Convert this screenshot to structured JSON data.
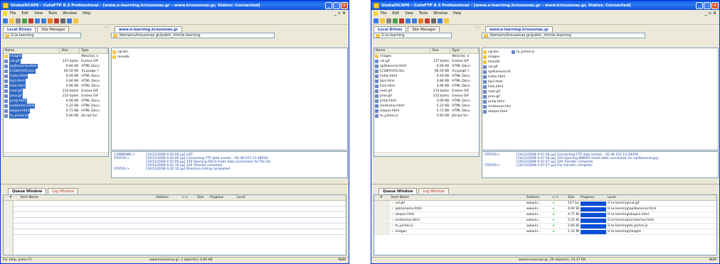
{
  "windows": [
    {
      "title": "GlobalSCAPE - CuteFTP 8.3 Professional - [www.e-learning.krousonas.gr - www.krousonas.gr, Status: Connected]",
      "menu": [
        "File",
        "Edit",
        "View",
        "Tools",
        "Window",
        "Help"
      ],
      "local_tabs": [
        "Local Drives",
        "Site Manager"
      ],
      "remote_tab": "www.e-learning.krousonas.gr",
      "local_path": "G:\\e-learning",
      "remote_path": "/domains/krousonas.gr/public_html/e-learning",
      "local_columns": [
        "Name",
        "Size",
        "Type"
      ],
      "local_files": [
        {
          "name": "images",
          "size": "",
          "type": "Φάκελος α",
          "folder": true
        },
        {
          "name": "cal.gif",
          "size": "127 bytes",
          "type": "Εικόνα GIF"
        },
        {
          "name": "aplikanonia.html",
          "size": "6.94 KB",
          "type": "HTML Docu"
        },
        {
          "name": "EΞΩΦΥΛΛΟ.doc",
          "size": "60.50 KB",
          "type": "Έγγραφο τ"
        },
        {
          "name": "index.html",
          "size": "6.49 KB",
          "type": "HTML Docu"
        },
        {
          "name": "lipsi.html",
          "size": "4.84 KB",
          "type": "HTML Docu"
        },
        {
          "name": "lista.html",
          "size": "4.96 KB",
          "type": "HTML Docu"
        },
        {
          "name": "next.gif",
          "size": "214 bytes",
          "type": "Εικόνα GIF"
        },
        {
          "name": "prev.gif",
          "size": "212 bytes",
          "type": "Εικόνα GIF"
        },
        {
          "name": "prolp.html",
          "size": "4.09 KB",
          "type": "HTML Docu"
        },
        {
          "name": "sindesmoi.html",
          "size": "5.22 KB",
          "type": "HTML Docu"
        },
        {
          "name": "skopos.html",
          "size": "4.71 KB",
          "type": "HTML Docu"
        },
        {
          "name": "to_picher.js",
          "size": "5.60 KB",
          "type": "JScript Scr"
        }
      ],
      "remote_files": [
        "cgi-bin",
        "moodle"
      ],
      "log": [
        {
          "k": "COMMAND:>",
          "t": "[10/12/2008 4:42:09 μμ] LIST"
        },
        {
          "k": "STATUS:>",
          "t": "[10/12/2008 4:42:09 μμ] Connecting FTP data socket... 92.48.107.13:38058..."
        },
        {
          "k": "",
          "t": "[10/12/2008 4:42:09 μμ] 150 Opening ASCII mode data connection for file list"
        },
        {
          "k": "",
          "t": "[10/12/2008 4:42:10 μμ] 226 Transfer complete"
        },
        {
          "k": "STATUS:>",
          "t": "[10/12/2008 4:42:10 μμ] Directory listing completed."
        }
      ],
      "queue_tabs": [
        "Queue Window",
        "Log Window"
      ],
      "queue_columns": [
        "#",
        "Item Name",
        "Address",
        "<->",
        "Size",
        "Progress",
        "Local"
      ],
      "queue_items": [],
      "status_left": "For Help, press F1",
      "status_center": "www.krousonas.gr, 2 object(s), 0.00 KB",
      "status_right": "NUM"
    },
    {
      "title": "GlobalSCAPE - CuteFTP 8.3 Professional - [www.e-learning.krousonas.gr - www.krousonas.gr, Status: Connected]",
      "menu": [
        "File",
        "Edit",
        "View",
        "Tools",
        "Window",
        "Help"
      ],
      "local_tabs": [
        "Local Drives",
        "Site Manager"
      ],
      "remote_tab": "www.e-learning.krousonas.gr",
      "local_path": "G:\\e-learning",
      "remote_path": "/domains/krousonas.gr/public_html/e-learning",
      "local_columns": [
        "Name",
        "Size",
        "Type"
      ],
      "local_files": [
        {
          "name": "images",
          "size": "",
          "type": "Φάκελος α",
          "folder": true
        },
        {
          "name": "cal.gif",
          "size": "127 bytes",
          "type": "Εικόνα GIF"
        },
        {
          "name": "aplikanonia.html",
          "size": "6.94 KB",
          "type": "HTML Docu"
        },
        {
          "name": "EΞΩΦΥΛΛΟ.doc",
          "size": "60.50 KB",
          "type": "Έγγραφο τ"
        },
        {
          "name": "index.html",
          "size": "6.49 KB",
          "type": "HTML Docu"
        },
        {
          "name": "lipsi.html",
          "size": "4.84 KB",
          "type": "HTML Docu"
        },
        {
          "name": "lista.html",
          "size": "4.96 KB",
          "type": "HTML Docu"
        },
        {
          "name": "next.gif",
          "size": "214 bytes",
          "type": "Εικόνα GIF"
        },
        {
          "name": "prev.gif",
          "size": "212 bytes",
          "type": "Εικόνα GIF"
        },
        {
          "name": "prolp.html",
          "size": "4.09 KB",
          "type": "HTML Docu"
        },
        {
          "name": "sindesmoi.html",
          "size": "5.22 KB",
          "type": "HTML Docu"
        },
        {
          "name": "skopos.html",
          "size": "4.71 KB",
          "type": "HTML Docu"
        },
        {
          "name": "to_picher.js",
          "size": "5.60 KB",
          "type": "JScript Scr"
        }
      ],
      "remote_files": [
        "cgi-bin",
        "images",
        "moodle",
        "cal.gif",
        "aplikanonia.html",
        "index.html",
        "lipsi.html",
        "lista.html",
        "next.gif",
        "prev.gif",
        "prolp.html",
        "sindesmoi.html",
        "skopos.html"
      ],
      "remote_files_col2": [
        "to_picher.js"
      ],
      "log": [
        {
          "k": "STATUS:>",
          "t": "[10/12/2008 4:47:26 μμ] Connecting FTP data socket... 92.48.107.13:39456..."
        },
        {
          "k": "",
          "t": "[10/12/2008 4:47:26 μμ] 150 Opening BINARY mode data connection for aplikanonia.jpg"
        },
        {
          "k": "",
          "t": "[10/12/2008 4:47:27 μμ] 226 Transfer complete"
        },
        {
          "k": "STATUS:>",
          "t": "[10/12/2008 4:47:27 μμ] File transfer complete."
        }
      ],
      "queue_tabs": [
        "Queue Window",
        "Log Window"
      ],
      "queue_columns": [
        "#",
        "Item Name",
        "Address",
        "<->",
        "Size",
        "Progress",
        "Local"
      ],
      "queue_items": [
        {
          "name": "cal.gif",
          "address": "www.kr...",
          "size": "127 bytes",
          "local": "G:\\e-learning\\cal.gif",
          "progress": 1
        },
        {
          "name": "aplikanonia.html",
          "address": "www.kr...",
          "size": "6.94 KB",
          "local": "G:\\e-learning\\aplikanonia.html",
          "progress": 1
        },
        {
          "name": "skopos.html",
          "address": "www.kr...",
          "size": "4.71 KB",
          "local": "G:\\e-learning\\skopos.html",
          "progress": 1
        },
        {
          "name": "sindesmoi.html",
          "address": "www.kr...",
          "size": "5.22 KB",
          "local": "G:\\e-learning\\sindesmoi.html",
          "progress": 1
        },
        {
          "name": "to_picher.js",
          "address": "www.kr...",
          "size": "5.60 KB",
          "local": "G:\\e-learning\\to_picher.js",
          "progress": 1
        },
        {
          "name": "images",
          "address": "www.kr...",
          "size": "1.31 MB",
          "local": "G:\\e-learning\\images",
          "progress": 1
        }
      ],
      "status_left": "",
      "status_center": "www.krousonas.gr, 16 object(s), 54.37 KB",
      "status_right": "NUM"
    }
  ],
  "colors": {
    "titlebar": "#0a58e8",
    "selection": "#316ac5",
    "progress": "#0a4fd8",
    "link_text": "#1a3fa8"
  }
}
